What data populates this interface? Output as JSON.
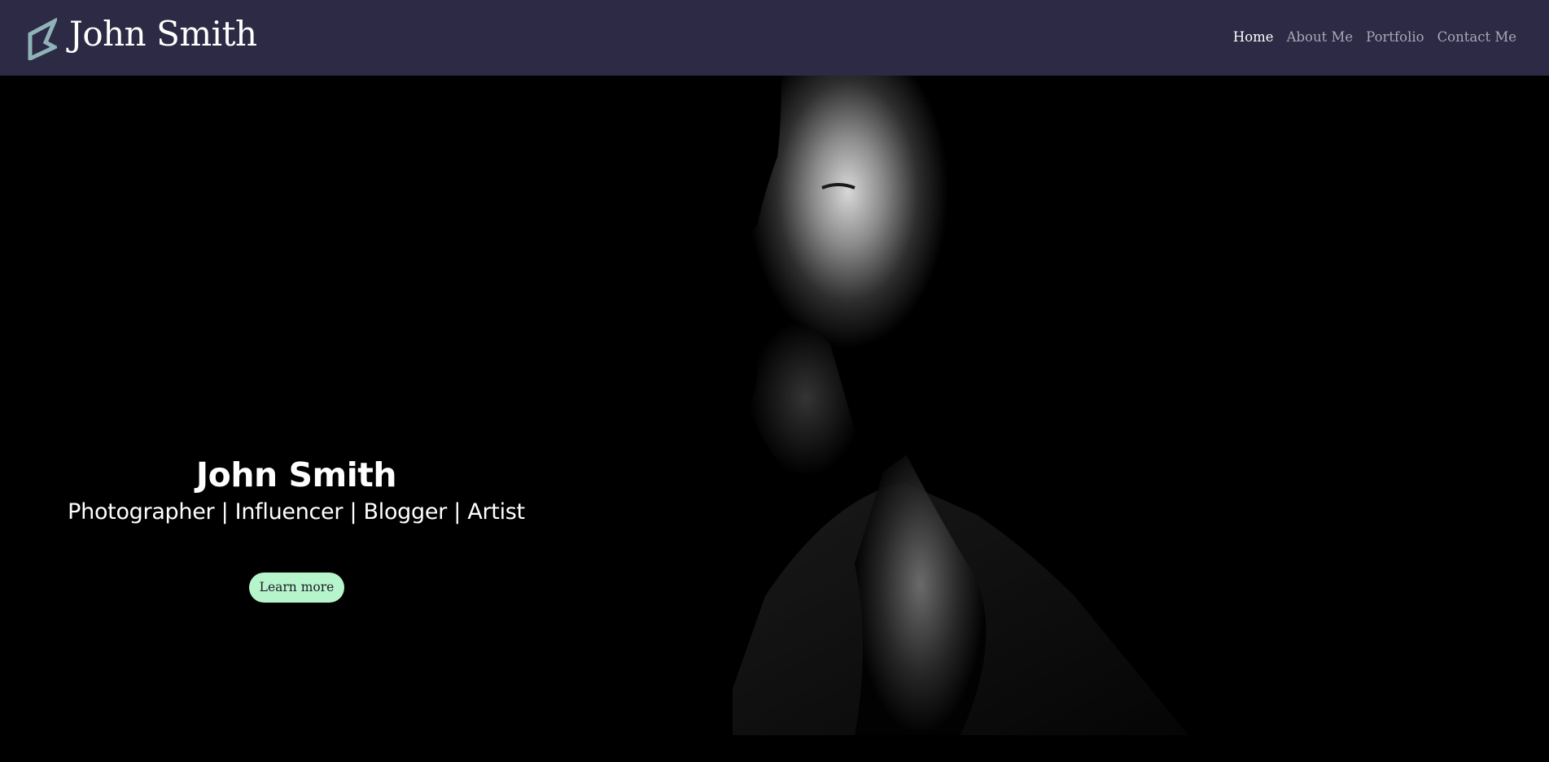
{
  "brand": {
    "name": "John Smith",
    "logo_icon": "triangle-logo-icon",
    "logo_color": "#8fb3b8"
  },
  "nav": {
    "items": [
      {
        "label": "Home",
        "active": true
      },
      {
        "label": "About Me",
        "active": false
      },
      {
        "label": "Portfolio",
        "active": false
      },
      {
        "label": "Contact Me",
        "active": false
      }
    ]
  },
  "hero": {
    "title": "John Smith",
    "subtitle": "Photographer | Influencer | Blogger | Artist",
    "cta_label": "Learn more",
    "image_subject": "profile-portrait-photo"
  },
  "colors": {
    "navbar_bg": "#2c2a44",
    "hero_bg": "#000000",
    "cta_bg": "#b6f5cb",
    "nav_inactive": "#a9a7b6",
    "nav_active": "#ffffff"
  }
}
